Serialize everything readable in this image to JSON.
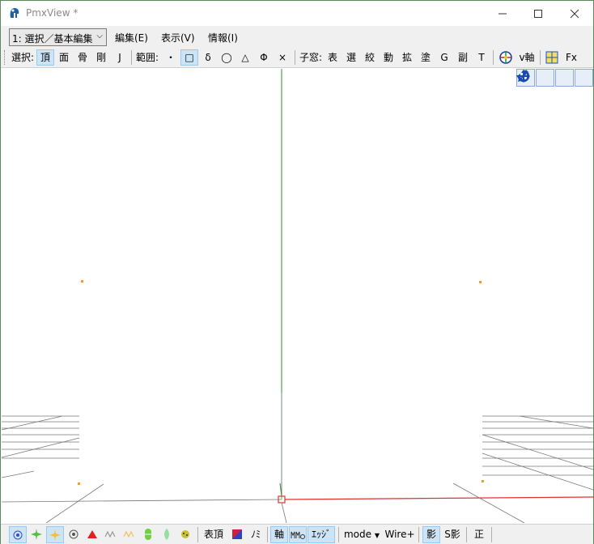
{
  "window": {
    "title": "PmxView *",
    "minimize_glyph": "—",
    "maximize_glyph": "☐",
    "close_glyph": "✕"
  },
  "menubar": {
    "mode_select": "1: 選択／基本編集",
    "items": [
      "編集(E)",
      "表示(V)",
      "情報(I)"
    ]
  },
  "toolbar": {
    "select_label": "選択:",
    "select_items": [
      "頂",
      "面",
      "骨",
      "剛",
      "J"
    ],
    "range_label": "範囲:",
    "range_items": [
      "・",
      "□",
      "δ",
      "◯",
      "△",
      "Φ",
      "×"
    ],
    "subwin_label": "子窓:",
    "subwin_items": [
      "表",
      "選",
      "絞",
      "動",
      "拡",
      "塗",
      "G",
      "副",
      "T"
    ],
    "vaxis_label": "v軸",
    "fx_label": "Fx"
  },
  "bottombar": {
    "labels": {
      "vertex_table": "表頂",
      "nomi": "ﾉﾐ",
      "axis": "軸",
      "edge": "ｴｯｼﾞ",
      "mode": "mode",
      "wire": "Wire+",
      "shadow": "影",
      "s_shadow": "S影",
      "ortho": "正"
    }
  },
  "colors": {
    "accent_active": "#cce4f7",
    "axis_green": "#2e8b2e",
    "axis_red": "#e03030",
    "vertex_orange": "#f0a020"
  }
}
